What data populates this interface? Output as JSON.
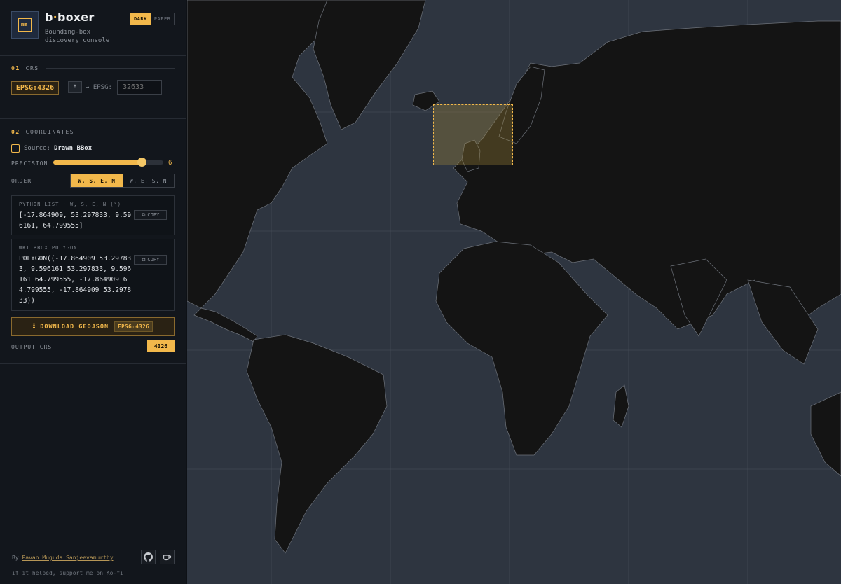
{
  "app": {
    "brand_b": "b",
    "brand_dot": "·",
    "brand_rest": "boxer",
    "subtitle": "Bounding-box discovery console",
    "logo_mark": "mm",
    "theme_dark": "DARK",
    "theme_paper": "PAPER"
  },
  "crs": {
    "num": "01",
    "title": "CRS",
    "current": "EPSG:4326",
    "star_label": "*",
    "arrow_label": "→ EPSG:",
    "input_placeholder": "32633"
  },
  "coordinates": {
    "num": "02",
    "title": "COORDINATES",
    "source_label": "Source:",
    "source_value": "Drawn BBox",
    "precision_label": "PRECISION",
    "precision_value": "6",
    "precision_fraction": 0.8,
    "order_label": "ORDER",
    "order_options": [
      "W, S, E, N",
      "W, E, S, N"
    ],
    "python_caption": "PYTHON LIST · W, S, E, N (°)",
    "python_text": "[-17.864909, 53.297833, 9.59\n6161, 64.799555]",
    "wkt_caption": "WKT BBOX POLYGON",
    "wkt_text": "POLYGON((-17.864909 53.29783\n3, 9.596161 53.297833, 9.596\n161 64.799555, -17.864909 6\n4.799555, -17.864909 53.2978\n33))",
    "copy_label": "COPY",
    "download_label": "DOWNLOAD GEOJSON",
    "download_tag": "EPSG:4326",
    "output_crs_label": "OUTPUT CRS",
    "output_crs_value": "4326"
  },
  "footer": {
    "by_prefix": "By",
    "author": "Pavan Muguda Sanjeevamurthy",
    "support": "if it helped, support me on Ko-fi"
  },
  "icons": {
    "github": "github-icon",
    "coffee": "coffee-icon",
    "copy": "copy-icon",
    "download": "download-icon"
  },
  "colors": {
    "accent": "#f2b84b",
    "land": "#141414",
    "ocean": "#2e3540",
    "panel": "#12161c"
  }
}
